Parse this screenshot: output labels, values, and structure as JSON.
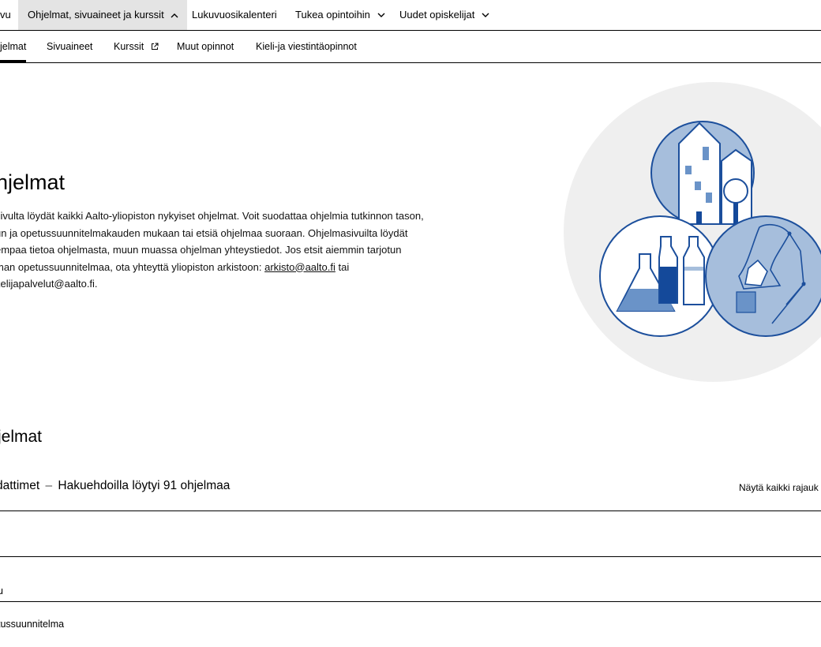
{
  "top_nav": {
    "items": [
      {
        "label": "vu",
        "has_chevron": false,
        "expanded": false
      },
      {
        "label": "Ohjelmat, sivuaineet ja kurssit",
        "has_chevron": true,
        "expanded": true
      },
      {
        "label": "Lukuvuosikalenteri",
        "has_chevron": false,
        "expanded": false
      },
      {
        "label": "Tukea opintoihin",
        "has_chevron": true,
        "expanded": false
      },
      {
        "label": "Uudet opiskelijat",
        "has_chevron": true,
        "expanded": false
      }
    ]
  },
  "sub_nav": {
    "items": [
      {
        "label": "jelmat",
        "active": true,
        "external": false
      },
      {
        "label": "Sivuaineet",
        "active": false,
        "external": false
      },
      {
        "label": "Kurssit",
        "active": false,
        "external": true
      },
      {
        "label": "Muut opinnot",
        "active": false,
        "external": false
      },
      {
        "label": "Kieli-ja viestintäopinnot",
        "active": false,
        "external": false
      }
    ]
  },
  "hero": {
    "title": "hjelmat",
    "lines": [
      " sivulta löydät kaikki Aalto-yliopiston nykyiset ohjelmat. Voit suodattaa ohjelmia tutkinnon tason,",
      "un ja opetussuunnitelmakauden mukaan tai etsiä ohjelmaa suoraan. Ohjelmasivuilta löydät",
      "empaa tietoa ohjelmasta, muun muassa ohjelman yhteystiedot. Jos etsit aiemmin tarjotun",
      "man opetussuunnitelmaa, ota yhteyttä yliopiston arkistoon: ",
      "kelijapalvelut@aalto.fi."
    ],
    "archive_email": "arkisto@aalto.fi",
    "after_email": " tai"
  },
  "illustration": {
    "icon": "study-programmes-illustration",
    "colors": {
      "background": "#efefef",
      "light_blue": "#a6bedc",
      "mid_blue": "#6a93c8",
      "dark_blue": "#14499a",
      "outline": "#1c4f9c"
    }
  },
  "programmes": {
    "section_title": "jelmat",
    "filters_label": "dattimet",
    "separator": "–",
    "results_text": "Hakuehdoilla löytyi 91 ohjelmaa",
    "show_all_label": "Näytä kaikki rajauk",
    "filter_rows": [
      {
        "label": ""
      },
      {
        "label": "u"
      },
      {
        "label": "tussuunnitelma"
      }
    ]
  }
}
